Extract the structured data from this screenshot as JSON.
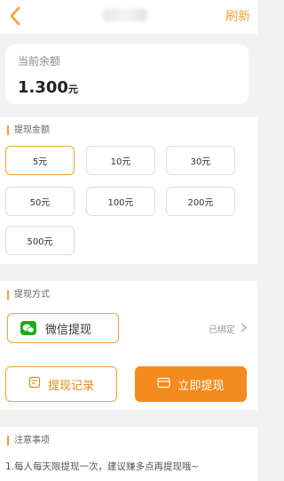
{
  "header": {
    "refresh_label": "刷新"
  },
  "balance": {
    "label": "当前余额",
    "amount": "1.300",
    "unit": "元"
  },
  "amount_section": {
    "title": "提现金额",
    "options": [
      "5元",
      "10元",
      "30元",
      "50元",
      "100元",
      "200元",
      "500元"
    ],
    "selected": "5元"
  },
  "method_section": {
    "title": "提现方式",
    "method_label": "微信提现",
    "bound_label": "已绑定"
  },
  "actions": {
    "record_label": "提现记录",
    "withdraw_label": "立即提现"
  },
  "notice_section": {
    "title": "注意事项",
    "text": "1.每人每天限提现一次，建议赚多点再提现哦~"
  },
  "colors": {
    "accent": "#f0a13a",
    "button": "#f58a1f",
    "wechat": "#1aad19"
  }
}
